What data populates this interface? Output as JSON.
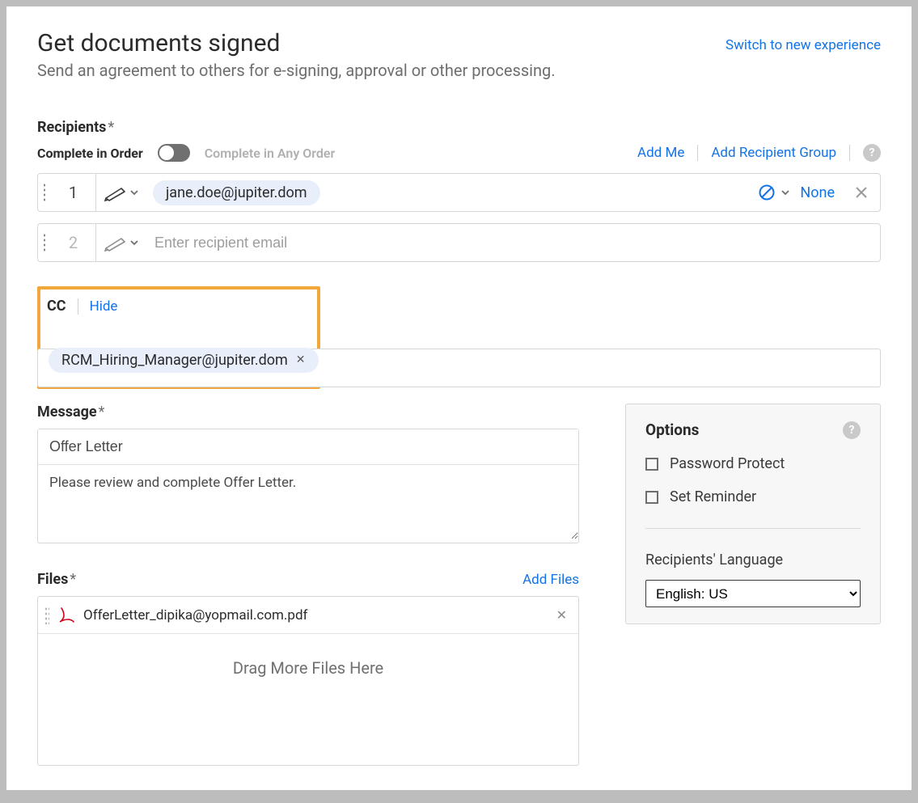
{
  "header": {
    "title": "Get documents signed",
    "subtitle": "Send an agreement to others for e-signing, approval or other processing.",
    "switch_link": "Switch to new experience"
  },
  "recipients": {
    "label": "Recipients",
    "required_mark": "*",
    "order_on_label": "Complete in Order",
    "order_off_label": "Complete in Any Order",
    "add_me": "Add Me",
    "add_group": "Add Recipient Group",
    "rows": [
      {
        "index": "1",
        "email": "jane.doe@jupiter.dom",
        "auth": "None"
      },
      {
        "index": "2",
        "placeholder": "Enter recipient email"
      }
    ]
  },
  "cc": {
    "label": "CC",
    "hide": "Hide",
    "chips": [
      "RCM_Hiring_Manager@jupiter.dom"
    ]
  },
  "message": {
    "label": "Message",
    "required_mark": "*",
    "subject": "Offer Letter",
    "body": "Please review and complete Offer Letter."
  },
  "files": {
    "label": "Files",
    "required_mark": "*",
    "add": "Add Files",
    "items": [
      "OfferLetter_dipika@yopmail.com.pdf"
    ],
    "drop_hint": "Drag More Files Here"
  },
  "options": {
    "title": "Options",
    "password": "Password Protect",
    "reminder": "Set Reminder",
    "lang_label": "Recipients' Language",
    "lang_value": "English: US"
  }
}
